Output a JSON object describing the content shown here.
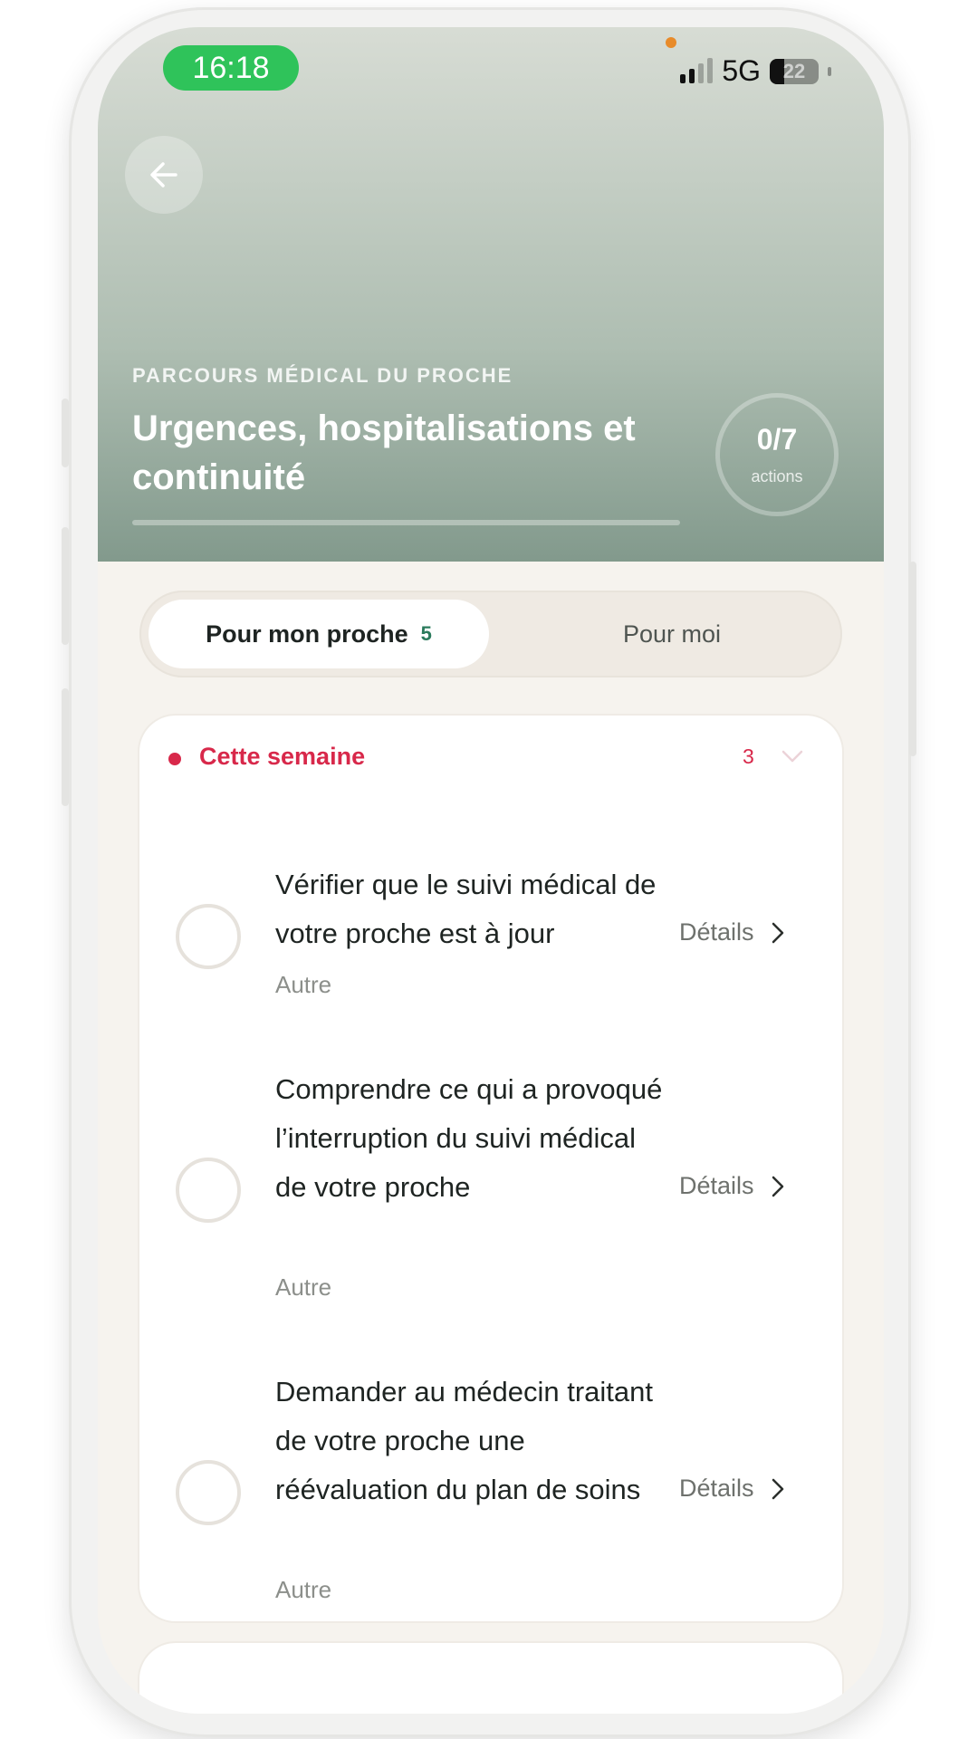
{
  "status_bar": {
    "time": "16:18",
    "network": "5G",
    "battery": "22"
  },
  "header": {
    "eyebrow": "PARCOURS MÉDICAL DU PROCHE",
    "title": "Urgences, hospitalisations et continuité",
    "progress_fraction": 0,
    "actions_count": "0/7",
    "actions_label": "actions"
  },
  "tabs": [
    {
      "label": "Pour mon proche",
      "count": "5",
      "active": true
    },
    {
      "label": "Pour moi",
      "active": false
    }
  ],
  "section": {
    "title": "Cette semaine",
    "count": "3",
    "items": [
      {
        "title": "Vérifier que le suivi médical de votre proche est à jour",
        "category": "Autre",
        "details_label": "Détails"
      },
      {
        "title": "Comprendre ce qui a provoqué l’interruption du suivi médical de votre proche",
        "category": "Autre",
        "details_label": "Détails"
      },
      {
        "title": "Demander au médecin traitant de votre proche une réévaluation du plan de soins",
        "category": "Autre",
        "details_label": "Détails"
      }
    ]
  },
  "colors": {
    "accent_red": "#d8284a",
    "accent_green": "#2b7b5c",
    "status_pill": "#2fc35a"
  },
  "icons": [
    "back-arrow-icon",
    "signal-icon",
    "battery-icon",
    "chevron-down-icon",
    "chevron-right-icon"
  ]
}
